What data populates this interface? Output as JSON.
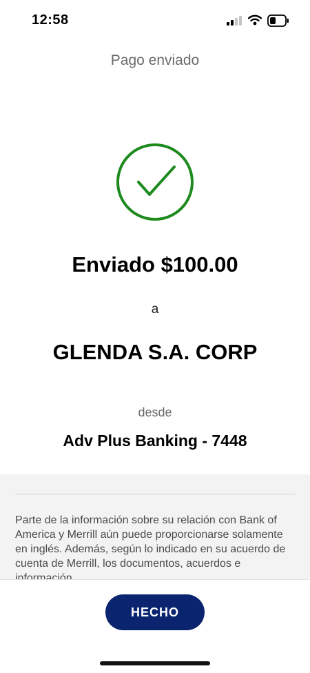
{
  "status_bar": {
    "time": "12:58",
    "icons": [
      "signal-icon",
      "wifi-icon",
      "battery-icon"
    ]
  },
  "header": {
    "title": "Pago enviado"
  },
  "confirmation": {
    "icon": "check-circle-icon",
    "icon_color": "#1e8a1e",
    "sent_text": "Enviado $100.00",
    "to_label": "a",
    "recipient": "GLENDA S.A. CORP",
    "from_label": "desde",
    "account": "Adv Plus Banking - 7448"
  },
  "disclosure": {
    "text": "Parte de la información sobre su relación con Bank of America y Merrill aún puede proporcionarse solamente en inglés. Además, según lo indicado en su acuerdo de cuenta de Merrill, los documentos, acuerdos e información"
  },
  "footer": {
    "done_label": "HECHO",
    "button_color": "#0a2470"
  }
}
